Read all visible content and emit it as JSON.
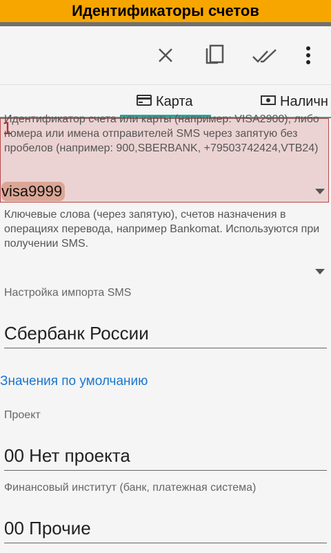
{
  "window": {
    "title": "Идентификаторы счетов"
  },
  "toolbar": {
    "close_icon": "close-icon",
    "copy_icon": "copy-icon",
    "done_all_icon": "done-all-icon",
    "more_icon": "more-vert-icon"
  },
  "tabs": [
    {
      "label": "Карта",
      "icon": "card-icon",
      "active": true
    },
    {
      "label": "Наличн",
      "icon": "cash-icon",
      "active": false
    }
  ],
  "form": {
    "badge": "1",
    "identifier_help": "Идентификатор счета или карты (например: VISA2900), либо номера или имена отправителей SMS через запятую без пробелов (например: 900,SBERBANK, +79503742424,VTB24)",
    "identifier_value": "visa9999",
    "keywords_help": "Ключевые слова (через запятую), счетов назначения в операциях перевода, например Bankomat. Используются при получении SMS.",
    "sms_import_label": "Настройка импорта SMS",
    "sms_import_value": "Сбербанк России",
    "defaults_link": "Значения по умолчанию",
    "project_label": "Проект",
    "project_value": "00 Нет проекта",
    "institution_label": "Финансовый институт (банк, платежная система)",
    "institution_value": "00 Прочие"
  },
  "colors": {
    "title_bar": "#f7a600",
    "accent": "#26a69a",
    "link": "#1976d2",
    "highlight": "#b64848"
  }
}
